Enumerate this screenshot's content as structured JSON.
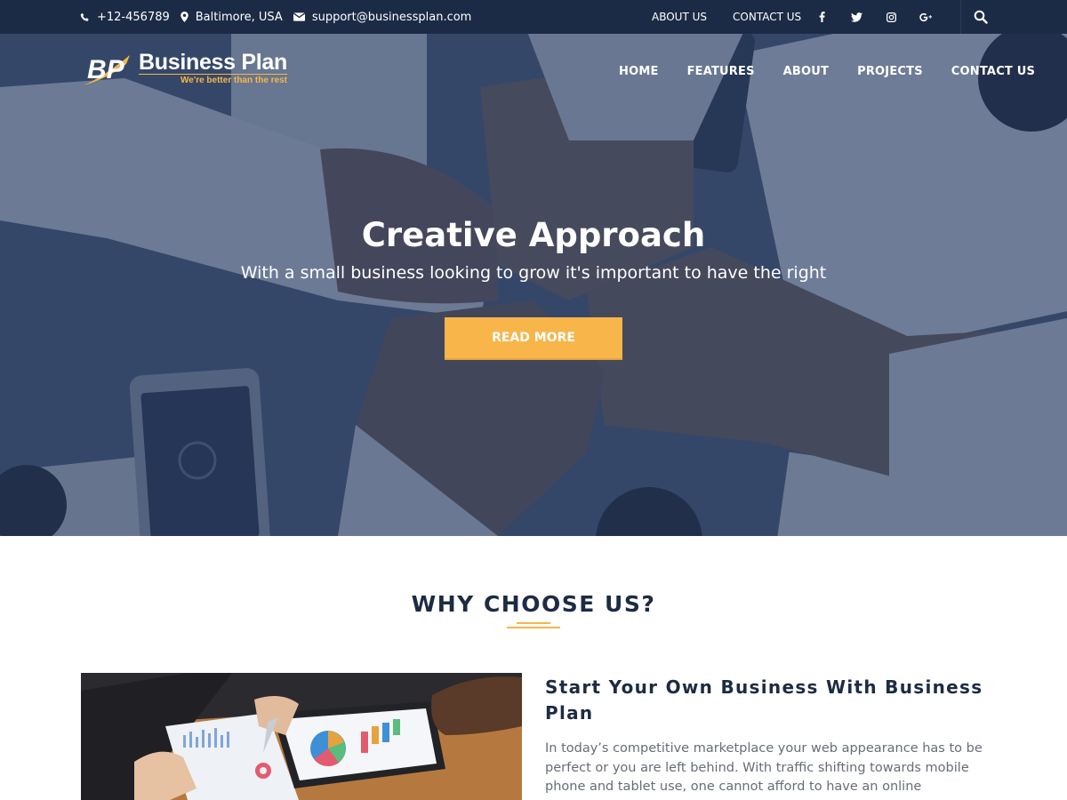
{
  "topbar": {
    "phone": "+12-456789",
    "location": "Baltimore, USA",
    "email": "support@businessplan.com",
    "links": [
      "ABOUT US",
      "CONTACT US"
    ],
    "social_icons": [
      "facebook-icon",
      "twitter-icon",
      "instagram-icon",
      "google-plus-icon"
    ],
    "search_icon": "search-icon"
  },
  "logo": {
    "mark": "BP",
    "name": "Business Plan",
    "tagline": "We're better than the rest"
  },
  "nav": {
    "items": [
      "HOME",
      "FEATURES",
      "ABOUT",
      "PROJECTS",
      "CONTACT US"
    ]
  },
  "hero": {
    "title": "Creative Approach",
    "subtitle": "With a small business looking to grow it's important to have the right",
    "button": "READ MORE"
  },
  "why": {
    "title": "WHY CHOOSE US?",
    "heading": "Start Your Own Business With Business Plan",
    "text": "In today’s competitive marketplace your web appearance has to be perfect or you are left behind. With traffic shifting towards mobile phone and tablet use, one cannot afford to have an online presences without a"
  },
  "colors": {
    "topbar_bg": "#1c2b45",
    "accent": "#f8b54a",
    "heading": "#1d2b43",
    "body_text": "#666d78"
  }
}
